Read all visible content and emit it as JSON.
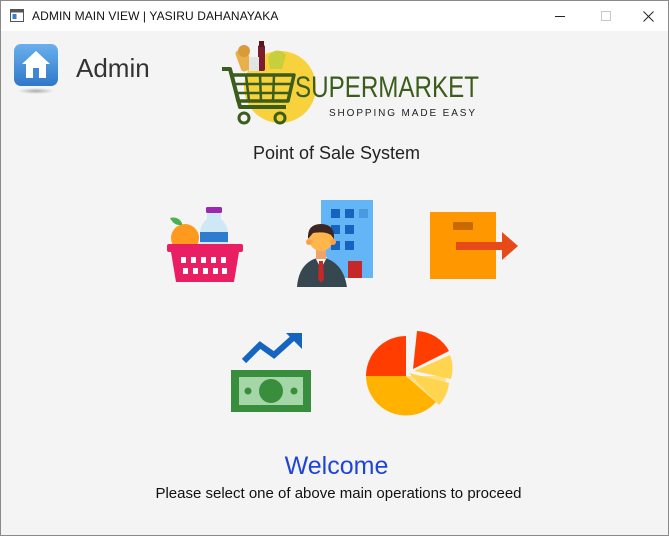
{
  "window": {
    "title": "ADMIN MAIN VIEW  |  YASIRU DAHANAYAKA"
  },
  "header": {
    "user_role": "Admin",
    "home_icon": "home-icon"
  },
  "logo": {
    "brand": "SUPERMARKET",
    "tagline": "SHOPPING MADE EASY",
    "icon": "shopping-cart-icon"
  },
  "main": {
    "system_title": "Point of Sale System",
    "operations": [
      {
        "icon": "grocery-basket-icon"
      },
      {
        "icon": "employee-building-icon"
      },
      {
        "icon": "box-exit-icon"
      },
      {
        "icon": "money-trend-icon"
      },
      {
        "icon": "pie-chart-icon"
      }
    ],
    "welcome": "Welcome",
    "instructions": "Please select one of above main operations to proceed"
  },
  "colors": {
    "welcome": "#1f45d6",
    "logo_green": "#3b5d1c",
    "logo_yellow": "#f7d23c"
  }
}
